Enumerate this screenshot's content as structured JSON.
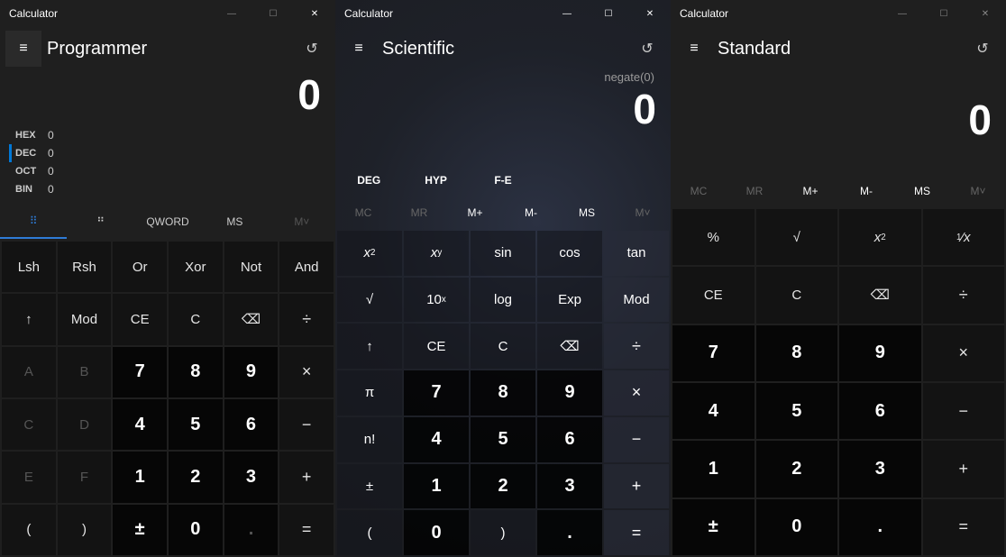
{
  "app_title": "Calculator",
  "caption": {
    "min": "—",
    "max": "☐",
    "close": "✕"
  },
  "hamburger_glyph": "≡",
  "history_glyph": "↺",
  "programmer": {
    "mode": "Programmer",
    "display": "0",
    "radixes": [
      {
        "label": "HEX",
        "value": "0",
        "active": false
      },
      {
        "label": "DEC",
        "value": "0",
        "active": true
      },
      {
        "label": "OCT",
        "value": "0",
        "active": false
      },
      {
        "label": "BIN",
        "value": "0",
        "active": false
      }
    ],
    "strip": {
      "qword": "QWORD",
      "ms": "MS",
      "mmin": "M˅"
    },
    "row1": [
      "Lsh",
      "Rsh",
      "Or",
      "Xor",
      "Not",
      "And"
    ],
    "row2": [
      "↑",
      "Mod",
      "CE",
      "C",
      "⌫",
      "÷"
    ],
    "row3": [
      "A",
      "B",
      "7",
      "8",
      "9",
      "×"
    ],
    "row4": [
      "C",
      "D",
      "4",
      "5",
      "6",
      "−"
    ],
    "row5": [
      "E",
      "F",
      "1",
      "2",
      "3",
      "+"
    ],
    "row6": [
      "(",
      ")",
      "±",
      "0",
      ".",
      "="
    ]
  },
  "scientific": {
    "mode": "Scientific",
    "expression": "negate(0)",
    "display": "0",
    "modes": [
      "DEG",
      "HYP",
      "F-E"
    ],
    "memory": [
      "MC",
      "MR",
      "M+",
      "M-",
      "MS",
      "M˅"
    ],
    "row1": [
      "x²",
      "xʸ",
      "sin",
      "cos",
      "tan"
    ],
    "row2": [
      "√",
      "10ˣ",
      "log",
      "Exp",
      "Mod"
    ],
    "row3": [
      "↑",
      "CE",
      "C",
      "⌫",
      "÷"
    ],
    "row4": [
      "π",
      "7",
      "8",
      "9",
      "×"
    ],
    "row5": [
      "n!",
      "4",
      "5",
      "6",
      "−"
    ],
    "row6": [
      "±",
      "1",
      "2",
      "3",
      "+"
    ],
    "row7": [
      "(",
      "0",
      ")",
      ".",
      "="
    ]
  },
  "standard": {
    "mode": "Standard",
    "display": "0",
    "memory": [
      "MC",
      "MR",
      "M+",
      "M-",
      "MS",
      "M˅"
    ],
    "row1": [
      "%",
      "√",
      "x²",
      "¹⁄ₓ"
    ],
    "row2": [
      "CE",
      "C",
      "⌫",
      "÷"
    ],
    "row3": [
      "7",
      "8",
      "9",
      "×"
    ],
    "row4": [
      "4",
      "5",
      "6",
      "−"
    ],
    "row5": [
      "1",
      "2",
      "3",
      "+"
    ],
    "row6": [
      "±",
      "0",
      ".",
      "="
    ]
  }
}
